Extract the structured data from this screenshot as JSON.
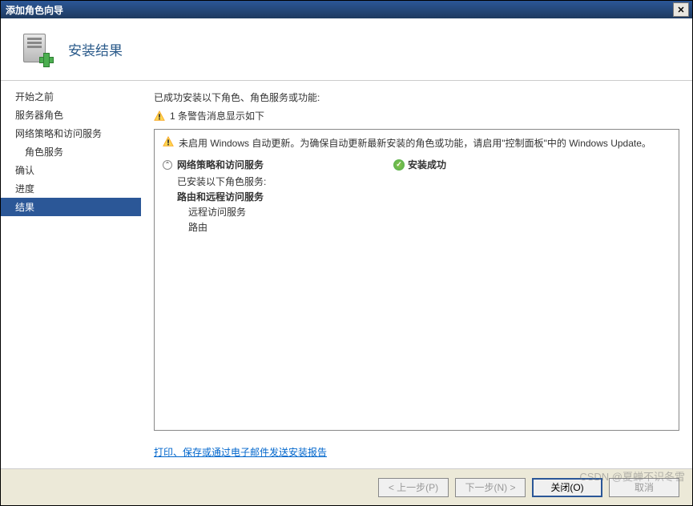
{
  "titlebar": {
    "title": "添加角色向导"
  },
  "header": {
    "title": "安装结果"
  },
  "sidebar": {
    "items": [
      {
        "label": "开始之前",
        "indent": false,
        "active": false
      },
      {
        "label": "服务器角色",
        "indent": false,
        "active": false
      },
      {
        "label": "网络策略和访问服务",
        "indent": false,
        "active": false
      },
      {
        "label": "角色服务",
        "indent": true,
        "active": false
      },
      {
        "label": "确认",
        "indent": false,
        "active": false
      },
      {
        "label": "进度",
        "indent": false,
        "active": false
      },
      {
        "label": "结果",
        "indent": false,
        "active": true
      }
    ]
  },
  "content": {
    "success_message": "已成功安装以下角色、角色服务或功能:",
    "warning_summary": "1 条警告消息显示如下",
    "panel_warning": "未启用 Windows 自动更新。为确保自动更新最新安装的角色或功能，请启用\"控制面板\"中的 Windows Update。",
    "section": {
      "title": "网络策略和访问服务",
      "status": "安装成功",
      "installed_label": "已安装以下角色服务:",
      "items": [
        {
          "text": "路由和远程访问服务",
          "bold": true,
          "sub": false
        },
        {
          "text": "远程访问服务",
          "bold": false,
          "sub": true
        },
        {
          "text": "路由",
          "bold": false,
          "sub": true
        }
      ]
    },
    "report_link": "打印、保存或通过电子邮件发送安装报告"
  },
  "footer": {
    "prev": "< 上一步(P)",
    "next": "下一步(N) >",
    "close": "关闭(O)",
    "cancel": "取消"
  },
  "watermark": "CSDN @夏蝉不识冬雪"
}
